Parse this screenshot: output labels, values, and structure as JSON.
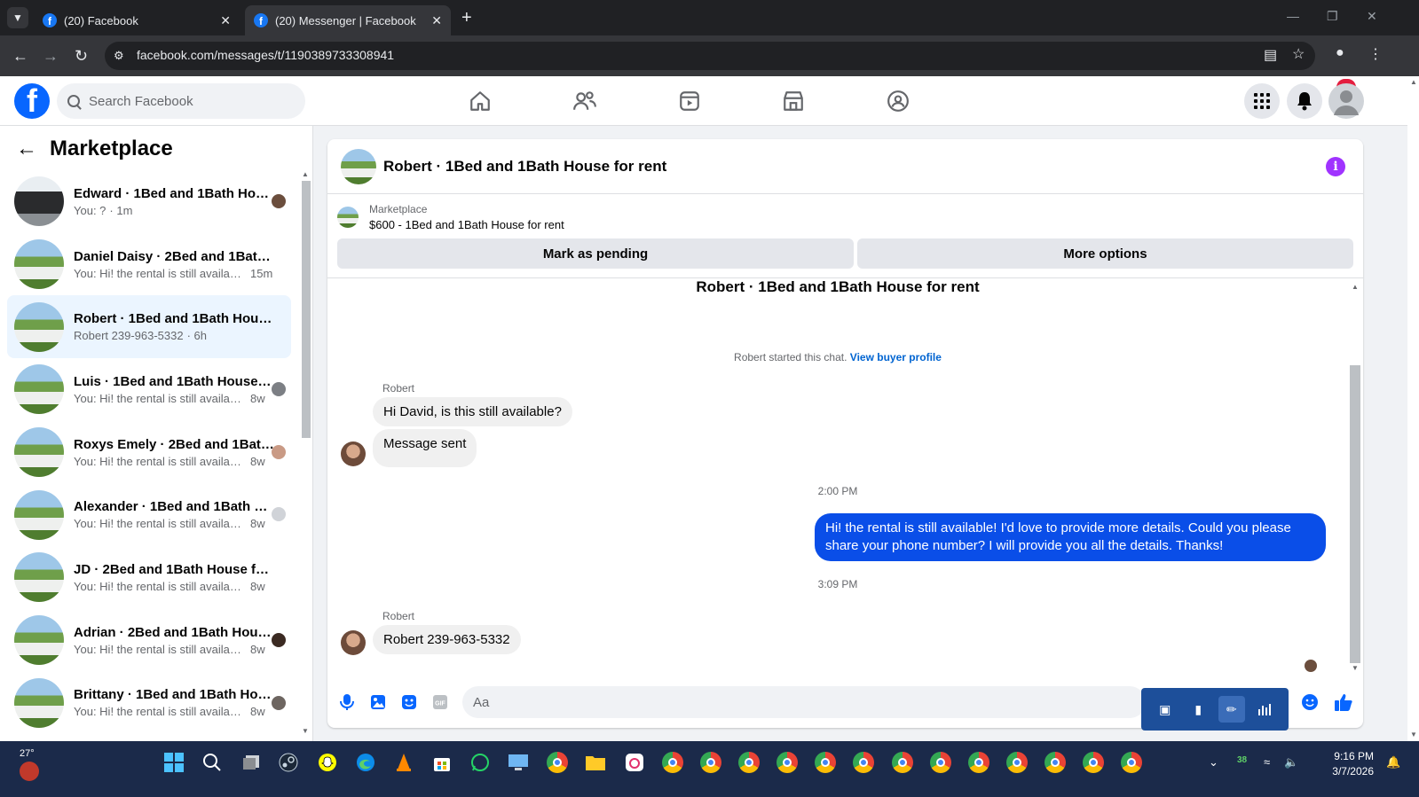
{
  "browser": {
    "tabs": [
      {
        "title": "(20) Facebook",
        "active": false
      },
      {
        "title": "(20) Messenger | Facebook",
        "active": true
      }
    ],
    "url": "facebook.com/messages/t/1190389733308941"
  },
  "header": {
    "search_placeholder": "Search Facebook",
    "notifications_count": "20",
    "accent": "#0866ff"
  },
  "sidebar": {
    "title": "Marketplace",
    "conversations": [
      {
        "name": "Edward · 1Bed and 1Bath Hou...",
        "preview": "You: ?",
        "time": "· 1m"
      },
      {
        "name": "Daniel Daisy · 2Bed and 1Bath H...",
        "preview": "You: Hi! the rental is still available...",
        "time": "15m"
      },
      {
        "name": "Robert · 1Bed and 1Bath House f...",
        "preview": "Robert 239-963-5332",
        "time": "· 6h"
      },
      {
        "name": "Luis · 1Bed and 1Bath House f...",
        "preview": "You: Hi! the rental is still availabl...",
        "time": "8w"
      },
      {
        "name": "Roxys Emely · 2Bed and 1Bath...",
        "preview": "You: Hi! the rental is still availabl...",
        "time": "8w"
      },
      {
        "name": "Alexander · 1Bed and 1Bath H...",
        "preview": "You: Hi! the rental is still availabl...",
        "time": "8w"
      },
      {
        "name": "JD · 2Bed and 1Bath House for r...",
        "preview": "You: Hi! the rental is still available! ...",
        "time": "8w"
      },
      {
        "name": "Adrian · 2Bed and 1Bath Hous...",
        "preview": "You: Hi! the rental is still availabl...",
        "time": "8w"
      },
      {
        "name": "Brittany · 1Bed and 1Bath Hou...",
        "preview": "You: Hi! the rental is still availabl...",
        "time": "8w"
      }
    ]
  },
  "chat": {
    "title": "Robert · 1Bed and 1Bath House for rent",
    "marketplace_label": "Marketplace",
    "listing": "$600 - 1Bed and 1Bath House for rent",
    "mark_pending": "Mark as pending",
    "more_options": "More options",
    "thread_title": "Robert · 1Bed and 1Bath House for rent",
    "started_text": "Robert started this chat.",
    "view_profile": "View buyer profile",
    "sender1": "Robert",
    "msg1": "Hi David, is this still available?",
    "msg2": "Message sent",
    "time1": "2:00 PM",
    "msg_out": "Hi! the rental is still available! I'd love to provide more details. Could you please share your phone number? I will provide you all the details. Thanks!",
    "time2": "3:09 PM",
    "sender2": "Robert",
    "msg3": "Robert 239-963-5332",
    "composer_placeholder": "Aa",
    "outgoing_color": "#0a4ee8"
  },
  "taskbar": {
    "temperature": "27°",
    "tray_badge": "38",
    "time": "9:16 PM",
    "date": "3/7/2026"
  }
}
